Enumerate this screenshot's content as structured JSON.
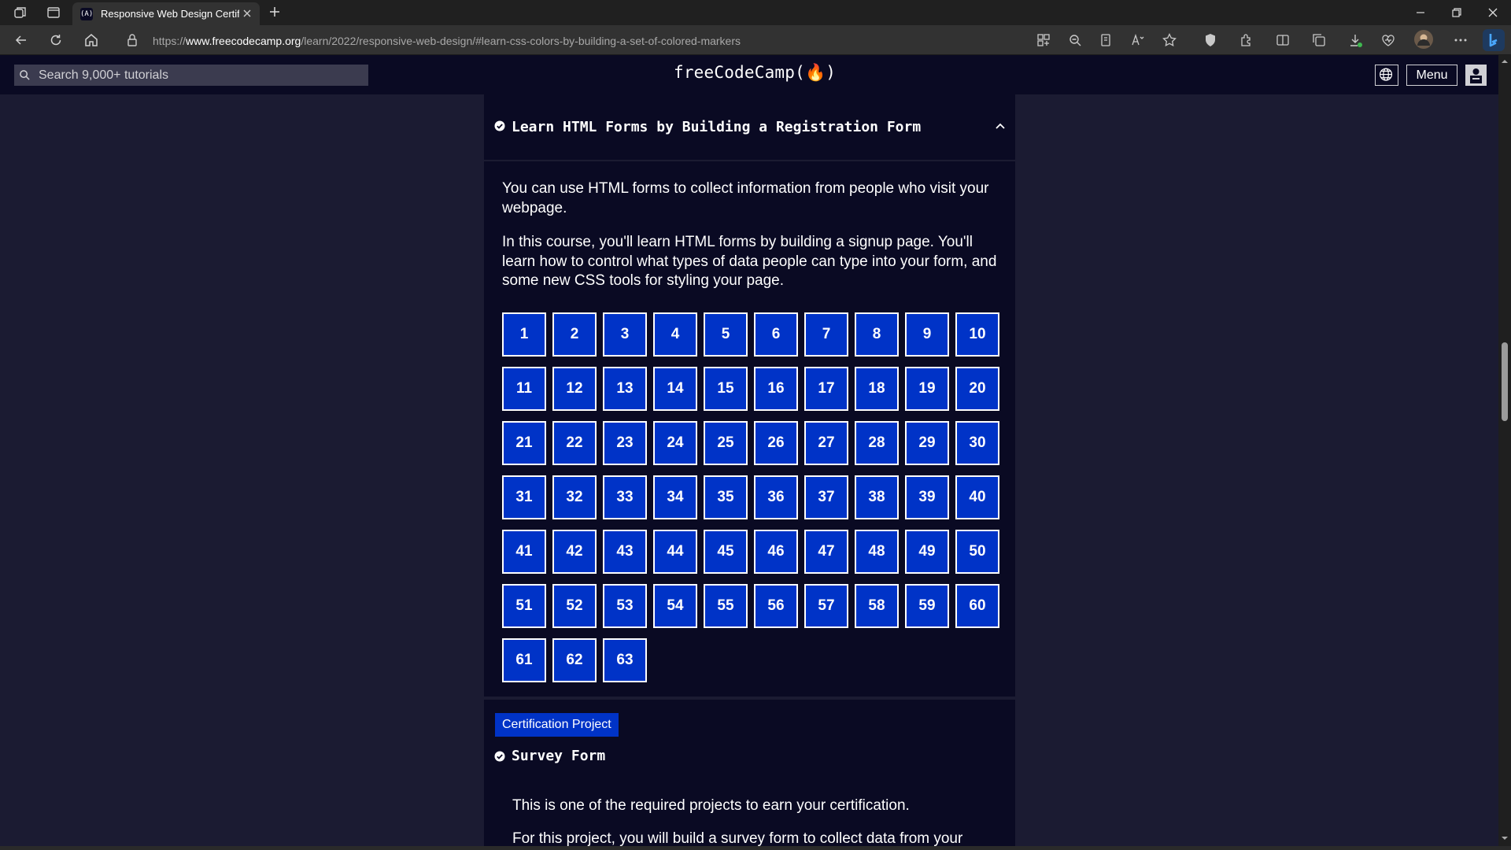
{
  "browser": {
    "tab_title": "Responsive Web Design Certifica",
    "tab_favicon": "(A)",
    "url_prefix": "https://",
    "url_host": "www.freecodecamp.org",
    "url_path": "/learn/2022/responsive-web-design/#learn-css-colors-by-building-a-set-of-colored-markers",
    "icons": [
      "workspaces-icon",
      "tab-actions-icon",
      "back-icon",
      "refresh-icon",
      "home-icon",
      "lock-icon",
      "app-available-icon",
      "zoom-out-icon",
      "immersive-reader-icon",
      "read-aloud-icon",
      "favorite-star-icon",
      "shield-icon",
      "extensions-icon",
      "split-screen-icon",
      "collections-icon",
      "downloads-icon",
      "browser-essentials-icon",
      "profile-icon",
      "more-icon",
      "bing-copilot-icon"
    ]
  },
  "header": {
    "search_placeholder": "Search 9,000+ tutorials",
    "logo": "freeCodeCamp(🔥)",
    "menu_label": "Menu"
  },
  "block": {
    "title": "Learn HTML Forms by Building a Registration Form",
    "intro_1": "You can use HTML forms to collect information from people who visit your webpage.",
    "intro_2": "In this course, you'll learn HTML forms by building a signup page. You'll learn how to control what types of data people can type into your form, and some new CSS tools for styling your page.",
    "steps": [
      "1",
      "2",
      "3",
      "4",
      "5",
      "6",
      "7",
      "8",
      "9",
      "10",
      "11",
      "12",
      "13",
      "14",
      "15",
      "16",
      "17",
      "18",
      "19",
      "20",
      "21",
      "22",
      "23",
      "24",
      "25",
      "26",
      "27",
      "28",
      "29",
      "30",
      "31",
      "32",
      "33",
      "34",
      "35",
      "36",
      "37",
      "38",
      "39",
      "40",
      "41",
      "42",
      "43",
      "44",
      "45",
      "46",
      "47",
      "48",
      "49",
      "50",
      "51",
      "52",
      "53",
      "54",
      "55",
      "56",
      "57",
      "58",
      "59",
      "60",
      "61",
      "62",
      "63"
    ]
  },
  "project": {
    "badge": "Certification Project",
    "title": "Survey Form",
    "desc_1": "This is one of the required projects to earn your certification.",
    "desc_2": "For this project, you will build a survey form to collect data from your"
  },
  "colors": {
    "page_bg": "#1b1b32",
    "content_bg": "#0a0a23",
    "accent_blue": "#0033c7"
  }
}
